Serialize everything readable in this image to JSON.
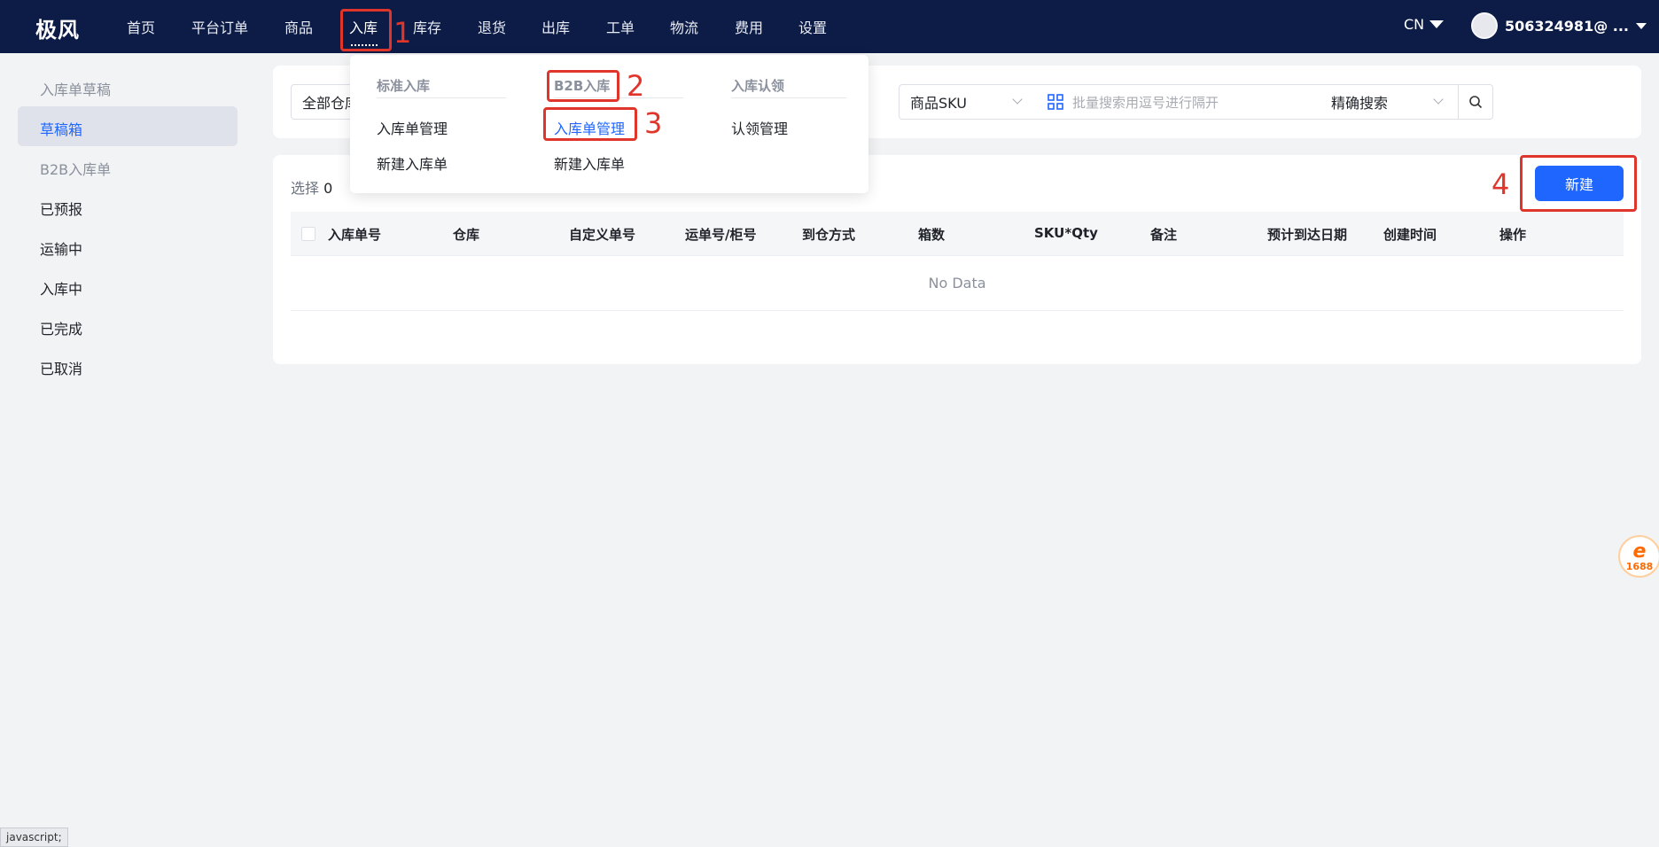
{
  "app": {
    "logo": "极风"
  },
  "nav": {
    "items": [
      "首页",
      "平台订单",
      "商品",
      "入库",
      "库存",
      "退货",
      "出库",
      "工单",
      "物流",
      "费用",
      "设置"
    ],
    "active": "入库",
    "lang": "CN",
    "user": "506324981@ ..."
  },
  "sidebar": {
    "items": [
      "入库单草稿",
      "草稿箱",
      "B2B入库单",
      "已预报",
      "运输中",
      "入库中",
      "已完成",
      "已取消"
    ],
    "active": "草稿箱"
  },
  "filters": {
    "warehouse": "全部仓库",
    "sku_select": "商品SKU",
    "batch_placeholder": "批量搜索用逗号进行隔开",
    "match_select": "精确搜索"
  },
  "table": {
    "select_label": "选择",
    "select_count": "0",
    "new_button": "新建",
    "columns": [
      "入库单号",
      "仓库",
      "自定义单号",
      "运单号/柜号",
      "到仓方式",
      "箱数",
      "SKU*Qty",
      "备注",
      "预计到达日期",
      "创建时间",
      "操作"
    ],
    "empty_text": "No Data"
  },
  "dropdown": {
    "groups": [
      {
        "title": "标准入库",
        "items": [
          "入库单管理",
          "新建入库单"
        ]
      },
      {
        "title": "B2B入库",
        "items": [
          "入库单管理",
          "新建入库单"
        ]
      },
      {
        "title": "入库认领",
        "items": [
          "认领管理"
        ]
      }
    ]
  },
  "annotations": {
    "labels": [
      "1",
      "2",
      "3",
      "4"
    ],
    "color": "#e0352b"
  },
  "statusbar": {
    "text": "javascript;"
  },
  "badge": {
    "text": "1688"
  },
  "colors": {
    "nav_bg": "#0d1c47",
    "accent": "#1f66ff"
  }
}
